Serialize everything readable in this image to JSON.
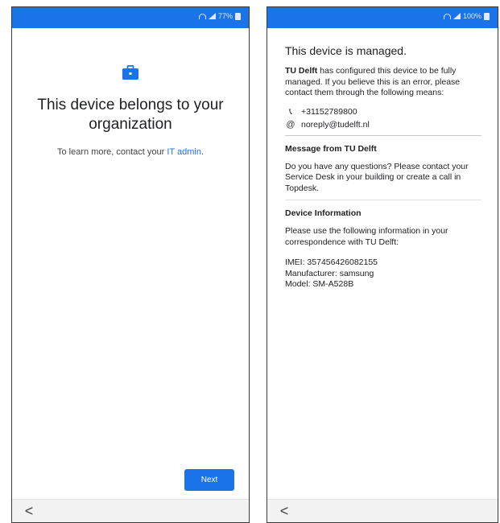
{
  "left_screen": {
    "status": {
      "battery_text": "77%"
    },
    "icon": "briefcase-icon",
    "title": "This device belongs to your organization",
    "description_prefix": "To learn more, contact your ",
    "description_link": "IT admin",
    "description_suffix": ".",
    "next_label": "Next",
    "back_label": "<"
  },
  "right_screen": {
    "status": {
      "battery_text": "100%"
    },
    "title": "This device is managed.",
    "org_name": "TU Delft",
    "intro_text": " has configured this device to be fully managed. If you believe this is an error, please contact them through the following means:",
    "phone": "+31152789800",
    "email": "noreply@tudelft.nl",
    "message_heading": "Message from TU Delft",
    "message_text": "Do you have any questions? Please contact your Service Desk in your building or create a call in Topdesk.",
    "device_heading": "Device Information",
    "device_intro": "Please use the following information in your correspondence with TU Delft:",
    "imei": "IMEI: 357456426082155",
    "manufacturer": "Manufacturer: samsung",
    "model": "Model: SM-A528B",
    "back_label": "<"
  },
  "colors": {
    "accent": "#1a73e8",
    "nav_bg": "#f2f2f2"
  }
}
